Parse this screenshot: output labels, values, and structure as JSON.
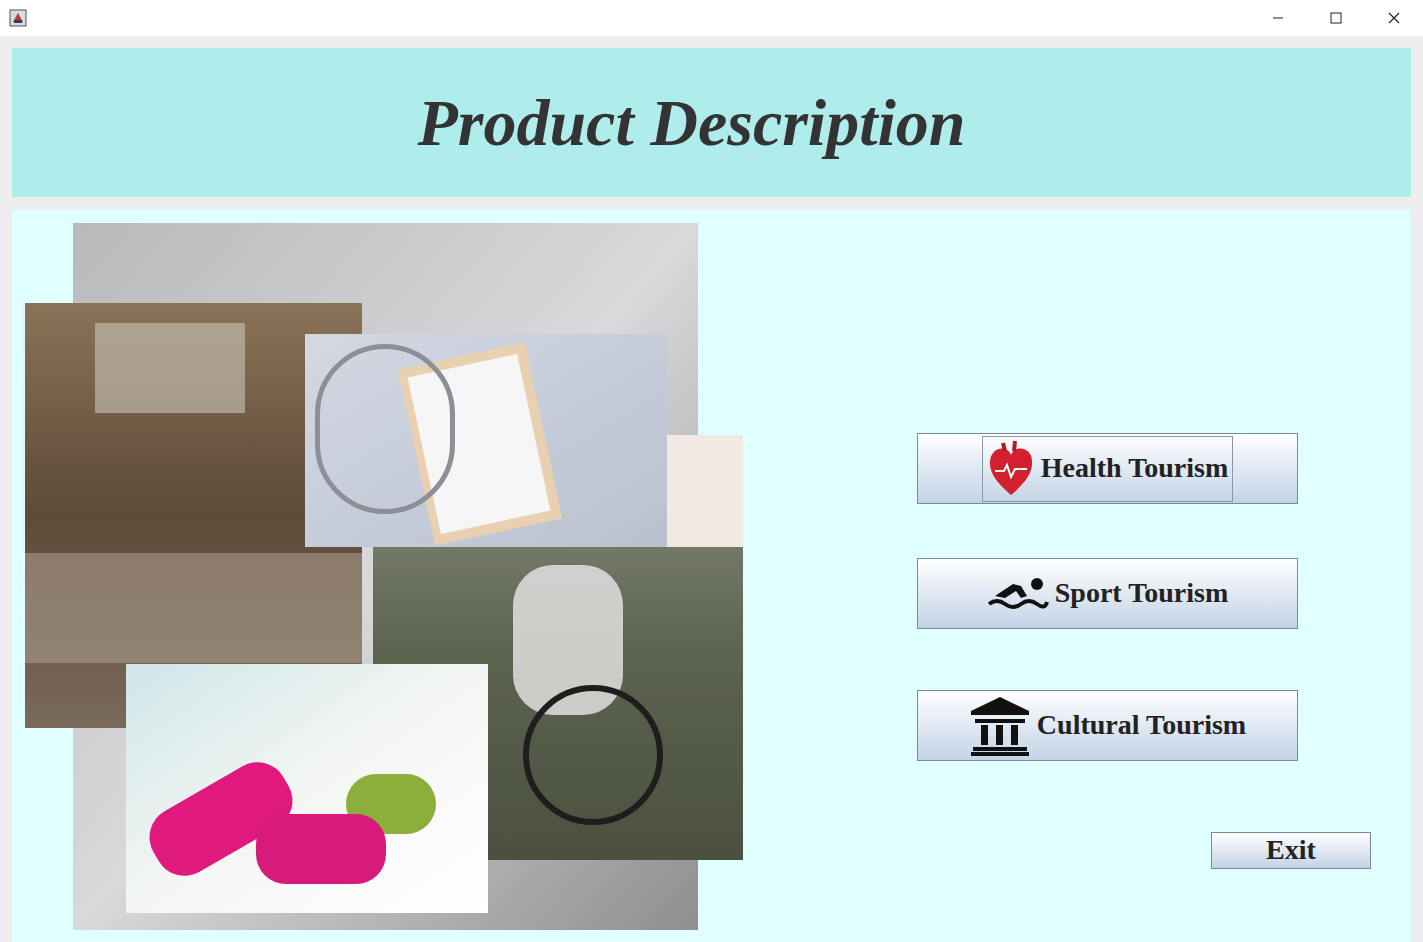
{
  "header": {
    "title": "Product Description"
  },
  "buttons": [
    {
      "label": "Health Tourism",
      "focused": true
    },
    {
      "label": "Sport Tourism",
      "focused": false
    },
    {
      "label": "Cultural Tourism",
      "focused": false
    }
  ],
  "exit_button": {
    "label": "Exit"
  }
}
